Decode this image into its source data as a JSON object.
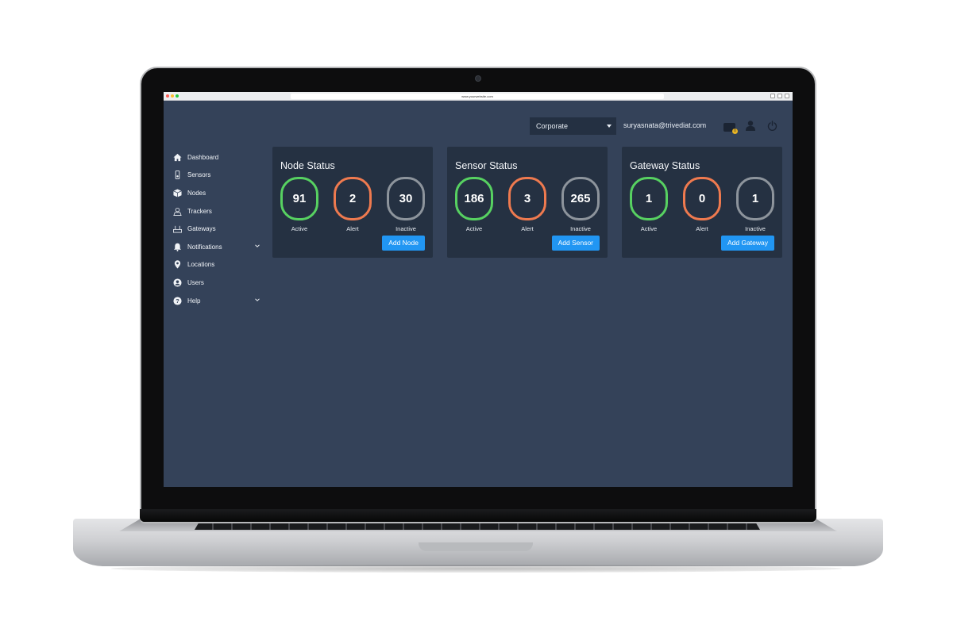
{
  "browser": {
    "url": "www.yourwebsite.com",
    "dot_colors": [
      "#fc5f57",
      "#fdbc2e",
      "#28c840"
    ]
  },
  "header": {
    "org_select": "Corporate",
    "user_email": "suryasnata@trivediat.com",
    "message_count": "0",
    "icons": [
      "message-icon",
      "user-icon",
      "power-icon"
    ]
  },
  "sidebar": {
    "items": [
      {
        "label": "Dashboard",
        "icon": "home-icon"
      },
      {
        "label": "Sensors",
        "icon": "sensor-icon"
      },
      {
        "label": "Nodes",
        "icon": "cube-icon"
      },
      {
        "label": "Trackers",
        "icon": "tracker-icon"
      },
      {
        "label": "Gateways",
        "icon": "gateway-icon"
      },
      {
        "label": "Notifications",
        "icon": "bell-icon",
        "expandable": true
      },
      {
        "label": "Locations",
        "icon": "map-pin-icon"
      },
      {
        "label": "Users",
        "icon": "user-circle-icon"
      },
      {
        "label": "Help",
        "icon": "help-icon",
        "expandable": true
      }
    ]
  },
  "cards": [
    {
      "title": "Node Status",
      "active": "91",
      "alert": "2",
      "inactive": "30",
      "active_label": "Active",
      "alert_label": "Alert",
      "inactive_label": "Inactive",
      "button": "Add Node"
    },
    {
      "title": "Sensor Status",
      "active": "186",
      "alert": "3",
      "inactive": "265",
      "active_label": "Active",
      "alert_label": "Alert",
      "inactive_label": "Inactive",
      "button": "Add Sensor"
    },
    {
      "title": "Gateway Status",
      "active": "1",
      "alert": "0",
      "inactive": "1",
      "active_label": "Active",
      "alert_label": "Alert",
      "inactive_label": "Inactive",
      "button": "Add Gateway"
    }
  ],
  "colors": {
    "background": "#344259",
    "card": "#253142",
    "active": "#57d161",
    "alert": "#ef7a4f",
    "inactive": "#8d949c",
    "button": "#2196f3"
  }
}
